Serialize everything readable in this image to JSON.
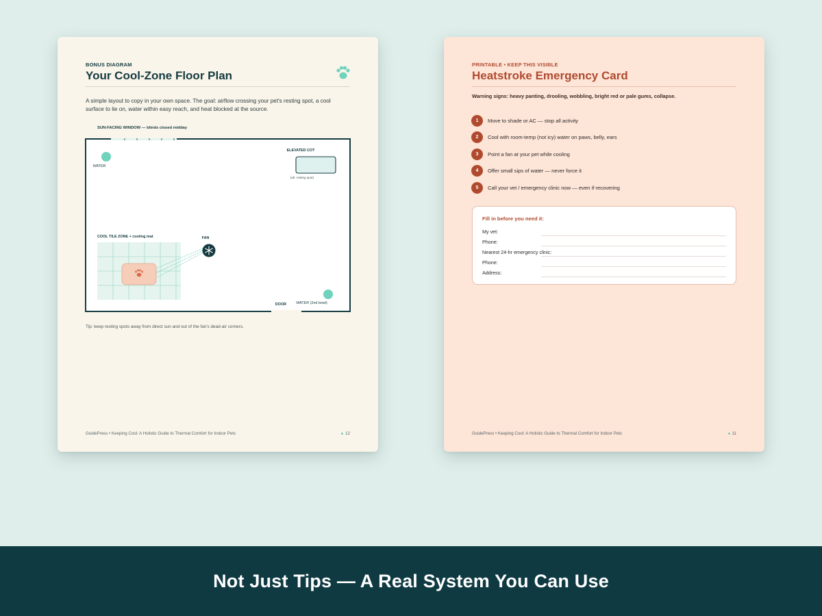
{
  "left_page": {
    "eyebrow": "BONUS DIAGRAM",
    "title": "Your Cool-Zone Floor Plan",
    "intro": "A simple layout to copy in your own space. The goal: airflow crossing your pet's resting spot, a cool surface to lie on, water within easy reach, and heat blocked at the source.",
    "plan": {
      "window_label": "SUN-FACING WINDOW — blinds closed midday",
      "water_label": "WATER",
      "cot_label": "ELEVATED COT",
      "cot_sub": "(alt. resting spot)",
      "tile_label": "COOL TILE ZONE + cooling mat",
      "fan_label": "FAN",
      "door_label": "DOOR",
      "water2_label": "WATER (2nd bowl)"
    },
    "tip": "Tip: keep resting spots away from direct sun and out of the fan's dead-air corners.",
    "footer_left": "GuidePress  •  Keeping Cool: A Holistic Guide to Thermal Comfort for Indoor Pets",
    "page_number": "12"
  },
  "right_page": {
    "eyebrow": "PRINTABLE  •  KEEP THIS VISIBLE",
    "title": "Heatstroke Emergency Card",
    "warning": "Warning signs: heavy panting, drooling, wobbling, bright red or pale gums, collapse.",
    "steps": [
      {
        "num": "1",
        "text": "Move to shade or AC — stop all activity"
      },
      {
        "num": "2",
        "text": "Cool with room-temp (not icy) water on paws, belly, ears"
      },
      {
        "num": "3",
        "text": "Point a fan at your pet while cooling"
      },
      {
        "num": "4",
        "text": "Offer small sips of water — never force it"
      },
      {
        "num": "5",
        "text": "Call your vet / emergency clinic now — even if recovering"
      }
    ],
    "card": {
      "title": "Fill in before you need it:",
      "fields": [
        "My vet:",
        "Phone:",
        "Nearest 24-hr emergency clinic:",
        "Phone:",
        "Address:"
      ]
    },
    "footer_left": "GuidePress  •  Keeping Cool: A Holistic Guide to Thermal Comfort for Indoor Pets",
    "page_number": "11"
  },
  "banner": {
    "text": "Not Just Tips — A Real System You Can Use"
  },
  "colors": {
    "teal_dark": "#143a40",
    "accent_mint": "#6fd2bd",
    "accent_rust": "#b04a2e",
    "banner_bg": "#0f3a42"
  },
  "icons": [
    "paw-icon",
    "fan-icon",
    "water-bowl-icon"
  ]
}
